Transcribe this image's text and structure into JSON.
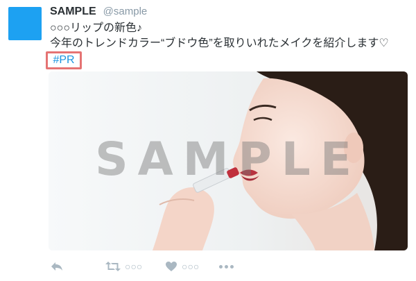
{
  "tweet": {
    "display_name": "SAMPLE",
    "handle": "@sample",
    "text_line1": "○○○リップの新色♪",
    "text_line2": "今年のトレンドカラー“ブドウ色”を取りいれたメイクを紹介します♡",
    "hashtag": "#PR"
  },
  "media": {
    "watermark": "SAMPLE",
    "alt": "Woman applying red lipstick"
  },
  "actions": {
    "reply_icon": "reply-icon",
    "retweet_icon": "retweet-icon",
    "retweet_count": "○○○",
    "like_icon": "heart-icon",
    "like_count": "○○○",
    "more_icon": "more-icon"
  },
  "colors": {
    "accent": "#1b95e0",
    "avatar": "#1da1f2",
    "highlight_border": "#e57373",
    "muted": "#aab8c2"
  }
}
